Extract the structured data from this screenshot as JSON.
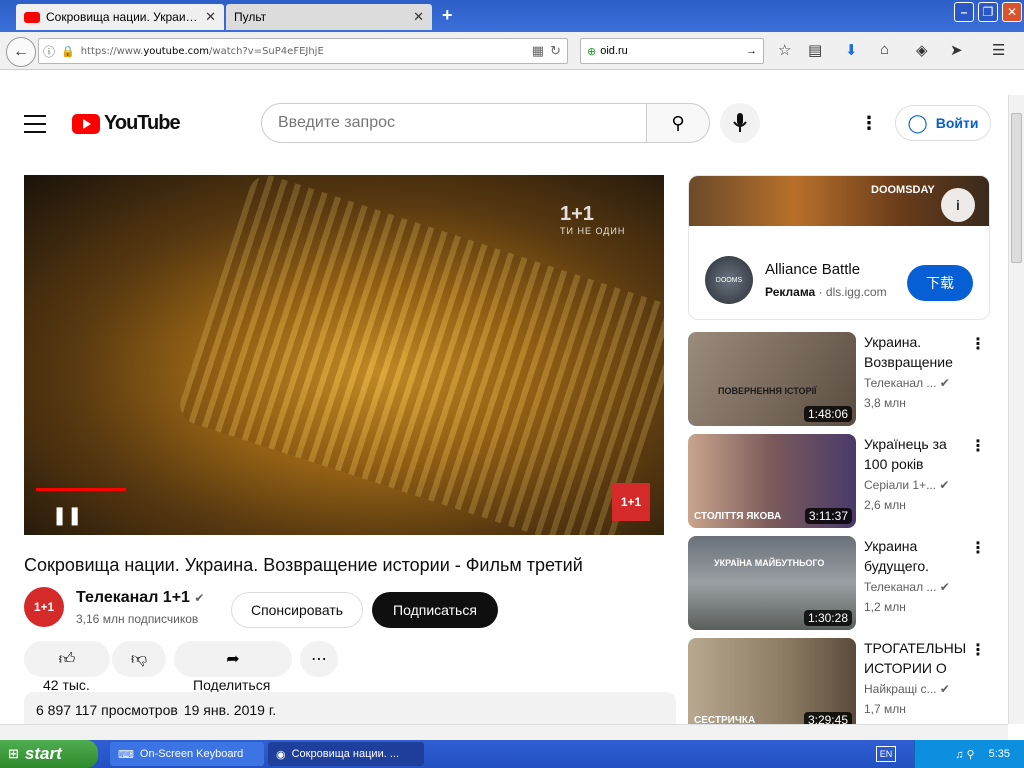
{
  "browser": {
    "tabs": [
      {
        "title": "Сокровища нации. Украина..."
      },
      {
        "title": "Пульт"
      }
    ],
    "url_prefix": "https://www.",
    "url_domain": "youtube.com",
    "url_path": "/watch?v=SuP4eFEJhjE",
    "search_value": "oid.ru"
  },
  "yt": {
    "logo_text": "YouTube",
    "search_placeholder": "Введите запрос",
    "signin_label": "Войти"
  },
  "video": {
    "title": "Сокровища нации. Украина. Возвращение истории - Фильм третий",
    "watermark_1": "1+1",
    "watermark_2": "ТИ НЕ ОДИН",
    "channel_logo": "1+1",
    "channel_name": "Телеканал 1+1",
    "subscribers": "3,16 млн подписчиков",
    "sponsor_label": "Спонсировать",
    "subscribe_label": "Подписаться",
    "likes": "42 тыс.",
    "share_label": "Поделиться",
    "views": "6 897 117 просмотров",
    "date": "19 янв. 2019 г."
  },
  "ad": {
    "banner_text": "DOOMSDAY",
    "name": "Alliance Battle",
    "sponsored": "Реклама",
    "domain": "dls.igg.com",
    "button": "下载",
    "avatar_text": "DOOMS"
  },
  "recommendations": [
    {
      "title": "Украина. Возвращение",
      "channel": "Телеканал ...",
      "views": "3,8 млн",
      "duration": "1:48:06",
      "thumb_text": "ПОВЕРНЕННЯ ІСТОРІЇ"
    },
    {
      "title": "Українець за 100 років",
      "channel": "Серіали 1+...",
      "views": "2,6 млн",
      "duration": "3:11:37",
      "thumb_text": "СТОЛІТТЯ ЯКОВА"
    },
    {
      "title": "Украина будущего.",
      "channel": "Телеканал ...",
      "views": "1,2 млн",
      "duration": "1:30:28",
      "thumb_text": "УКРАЇНА МАЙБУТНЬОГО"
    },
    {
      "title": "ТРОГАТЕЛЬНЫ ИСТОРИИ О",
      "channel": "Найкращі с...",
      "views": "1,7 млн",
      "duration": "3:29:45",
      "thumb_text": "СЕСТРИЧКА"
    }
  ],
  "taskbar": {
    "start": "start",
    "task1": "On-Screen Keyboard",
    "task2": "Сокровища нации. ...",
    "lang": "EN",
    "clock": "5:35"
  }
}
